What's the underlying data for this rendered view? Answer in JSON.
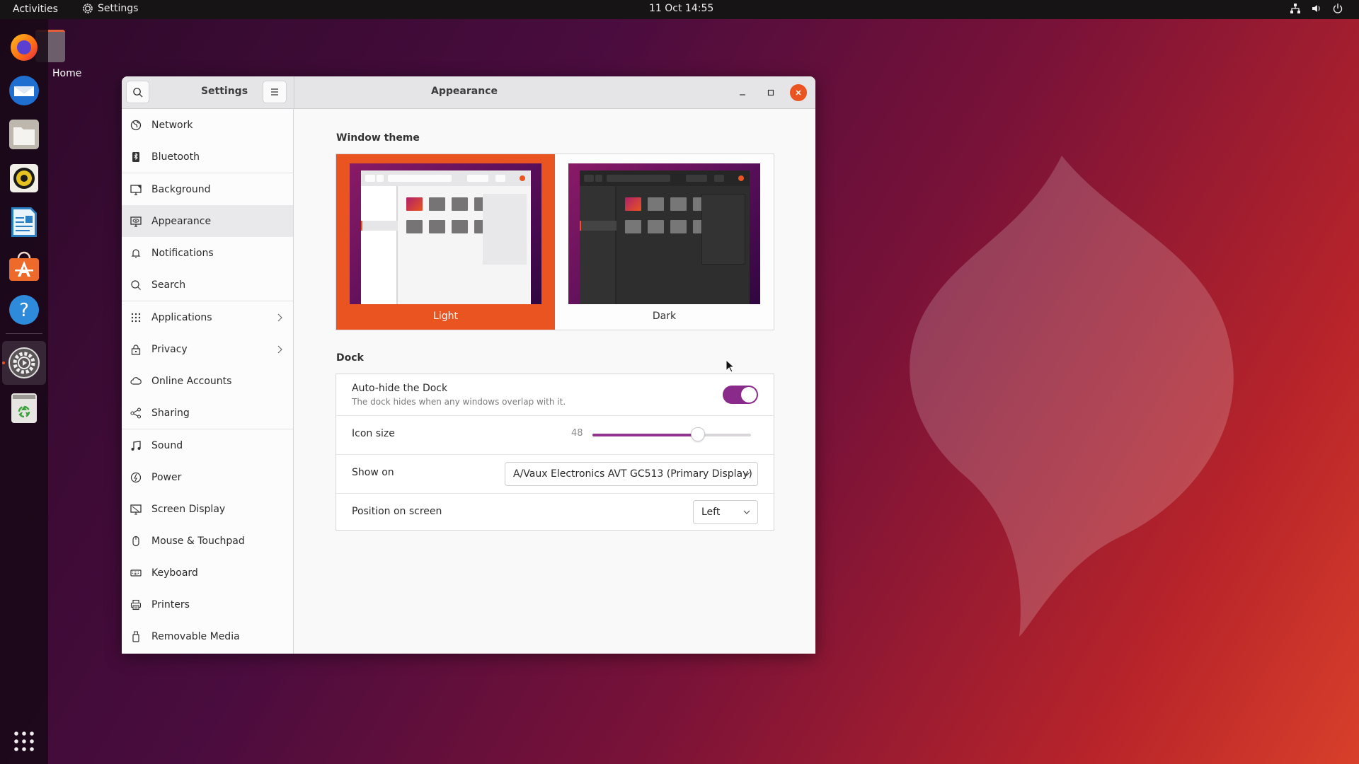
{
  "topbar": {
    "activities": "Activities",
    "app_name": "Settings",
    "clock": "11 Oct  14:55",
    "tray_icons": [
      "network-icon",
      "volume-icon",
      "power-icon"
    ]
  },
  "desktop": {
    "home_label": "Home"
  },
  "dock": {
    "items": [
      {
        "name": "Firefox",
        "icon": "firefox-icon"
      },
      {
        "name": "Thunderbird",
        "icon": "thunderbird-icon"
      },
      {
        "name": "Files",
        "icon": "files-icon"
      },
      {
        "name": "Rhythmbox",
        "icon": "rhythmbox-icon"
      },
      {
        "name": "LibreOffice Writer",
        "icon": "writer-icon"
      },
      {
        "name": "Ubuntu Software",
        "icon": "software-icon"
      },
      {
        "name": "Help",
        "icon": "help-icon"
      },
      {
        "name": "Settings",
        "icon": "settings-icon",
        "active": true
      },
      {
        "name": "Trash",
        "icon": "trash-icon"
      },
      {
        "name": "Show Applications",
        "icon": "app-grid-icon"
      }
    ]
  },
  "window": {
    "sidebar_title": "Settings",
    "main_title": "Appearance"
  },
  "sidebar": {
    "items": [
      {
        "label": "Network",
        "icon": "network-icon"
      },
      {
        "label": "Bluetooth",
        "icon": "bluetooth-icon"
      },
      {
        "label": "Background",
        "icon": "background-icon"
      },
      {
        "label": "Appearance",
        "icon": "appearance-icon",
        "selected": true
      },
      {
        "label": "Notifications",
        "icon": "bell-icon"
      },
      {
        "label": "Search",
        "icon": "search-icon"
      },
      {
        "label": "Applications",
        "icon": "apps-grid-icon",
        "has_submenu": true
      },
      {
        "label": "Privacy",
        "icon": "lock-icon",
        "has_submenu": true
      },
      {
        "label": "Online Accounts",
        "icon": "cloud-icon"
      },
      {
        "label": "Sharing",
        "icon": "share-icon"
      },
      {
        "label": "Sound",
        "icon": "music-note-icon"
      },
      {
        "label": "Power",
        "icon": "power-icon"
      },
      {
        "label": "Screen Display",
        "icon": "display-icon"
      },
      {
        "label": "Mouse & Touchpad",
        "icon": "mouse-icon"
      },
      {
        "label": "Keyboard",
        "icon": "keyboard-icon"
      },
      {
        "label": "Printers",
        "icon": "printer-icon"
      },
      {
        "label": "Removable Media",
        "icon": "usb-icon"
      }
    ]
  },
  "appearance": {
    "window_theme": {
      "title": "Window theme",
      "options": [
        {
          "label": "Light",
          "selected": true
        },
        {
          "label": "Dark",
          "selected": false
        }
      ],
      "accent_color": "#e95420"
    },
    "dock": {
      "title": "Dock",
      "autohide": {
        "label": "Auto-hide the Dock",
        "description": "The dock hides when any windows overlap with it.",
        "enabled": true
      },
      "icon_size": {
        "label": "Icon size",
        "value": 48,
        "value_text": "48",
        "min": 16,
        "max": 64
      },
      "show_on": {
        "label": "Show on",
        "selected": "A/Vaux Electronics AVT GC513 (Primary Display)"
      },
      "position": {
        "label": "Position on screen",
        "selected": "Left"
      },
      "toggle_color": "#8a2a8a"
    }
  }
}
